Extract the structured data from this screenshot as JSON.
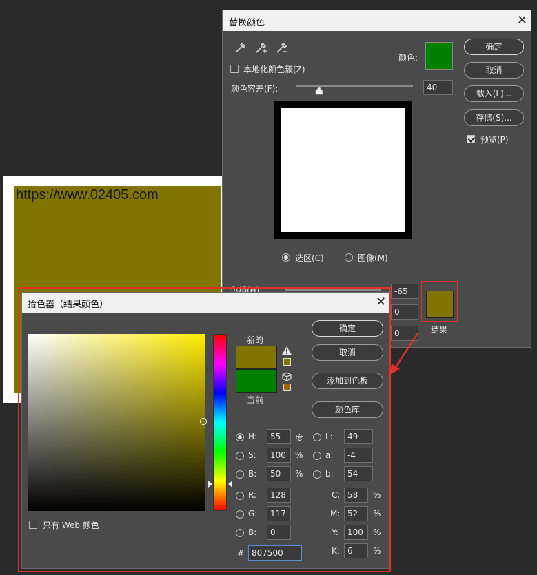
{
  "document": {
    "url_text": "https://www.02405.com",
    "fill_color": "#807500"
  },
  "replace_dialog": {
    "title": "替换颜色",
    "color_label": "颜色:",
    "sample_color": "#008000",
    "localized_clusters_label": "本地化颜色簇(Z)",
    "fuzziness_label": "颜色容差(F):",
    "fuzziness_value": "40",
    "fuzziness_fraction": 0.2,
    "buttons": {
      "ok": "确定",
      "cancel": "取消",
      "load": "载入(L)...",
      "save": "存储(S)..."
    },
    "preview_label": "预览(P)",
    "selection_label": "选区(C)",
    "image_label": "图像(M)",
    "hue_label": "色相(H):",
    "hue_value": "-65",
    "saturation_value": "0",
    "lightness_value": "0",
    "result_label": "结果",
    "result_color": "#807500"
  },
  "picker_dialog": {
    "title": "拾色器（结果颜色）",
    "new_label": "新的",
    "current_label": "当前",
    "new_color": "#807500",
    "current_color": "#008000",
    "gamut_swatch_color": "#807500",
    "web_swatch_color": "#996600",
    "buttons": {
      "ok": "确定",
      "cancel": "取消",
      "add_swatch": "添加到色板",
      "libraries": "颜色库"
    },
    "web_only_label": "只有 Web 颜色",
    "hsb": {
      "h_label": "H:",
      "h_value": "55",
      "h_unit": "度",
      "s_label": "S:",
      "s_value": "100",
      "s_unit": "%",
      "b_label": "B:",
      "b_value": "50",
      "b_unit": "%"
    },
    "lab": {
      "l_label": "L:",
      "l_value": "49",
      "a_label": "a:",
      "a_value": "-4",
      "b_label": "b:",
      "b_value": "54"
    },
    "rgb": {
      "r_label": "R:",
      "r_value": "128",
      "g_label": "G:",
      "g_value": "117",
      "b_label": "B:",
      "b_value": "0"
    },
    "cmyk": {
      "c_label": "C:",
      "c_value": "58",
      "c_unit": "%",
      "m_label": "M:",
      "m_value": "52",
      "m_unit": "%",
      "y_label": "Y:",
      "y_value": "100",
      "y_unit": "%",
      "k_label": "K:",
      "k_value": "6",
      "k_unit": "%"
    },
    "hex_label": "#",
    "hex_value": "807500",
    "hue_slider_fraction": 0.847
  },
  "colors": {
    "highlight": "#e0302a",
    "dialog_bg": "#4a4a4a",
    "titlebar": "#f0f0f0"
  }
}
